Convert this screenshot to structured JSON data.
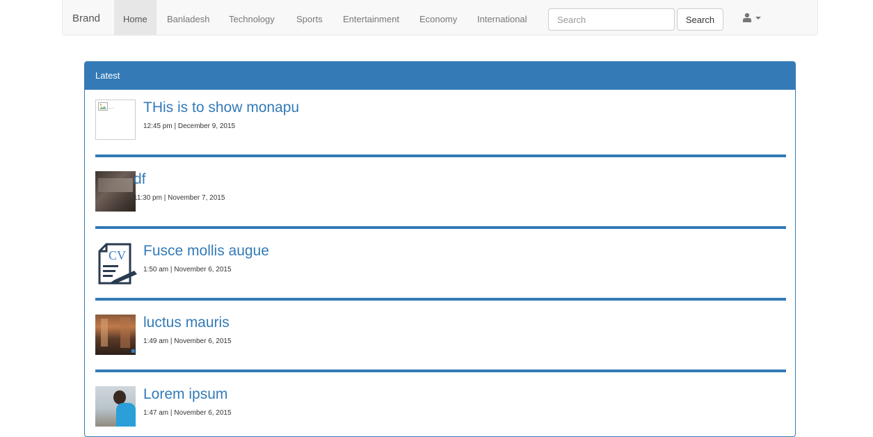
{
  "nav": {
    "brand": "Brand",
    "items": [
      {
        "label": "Home",
        "active": true
      },
      {
        "label": "Banladesh"
      },
      {
        "label": "Technology"
      },
      {
        "label": "Sports"
      },
      {
        "label": "Entertainment"
      },
      {
        "label": "Economy"
      },
      {
        "label": "International"
      }
    ],
    "search_placeholder": "Search",
    "search_button": "Search",
    "user_icon": "user-icon"
  },
  "panel": {
    "heading": "Latest",
    "items": [
      {
        "title": "THis is to show monapu",
        "meta": "12:45 pm | December 9, 2015",
        "thumb": "broken-image"
      },
      {
        "title": "df",
        "meta": "11:30 pm | November 7, 2015",
        "thumb": "photo-screen"
      },
      {
        "title": "Fusce mollis augue",
        "meta": "1:50 am | November 6, 2015",
        "thumb": "cv-document-icon",
        "thumb_label": "CV"
      },
      {
        "title": "luctus mauris",
        "meta": "1:49 am | November 6, 2015",
        "thumb": "photo-street"
      },
      {
        "title": "Lorem ipsum",
        "meta": "1:47 am | November 6, 2015",
        "thumb": "photo-person"
      }
    ]
  },
  "colors": {
    "primary": "#337ab7",
    "navbar_bg": "#f8f8f8",
    "nav_active_bg": "#e7e7e7"
  }
}
